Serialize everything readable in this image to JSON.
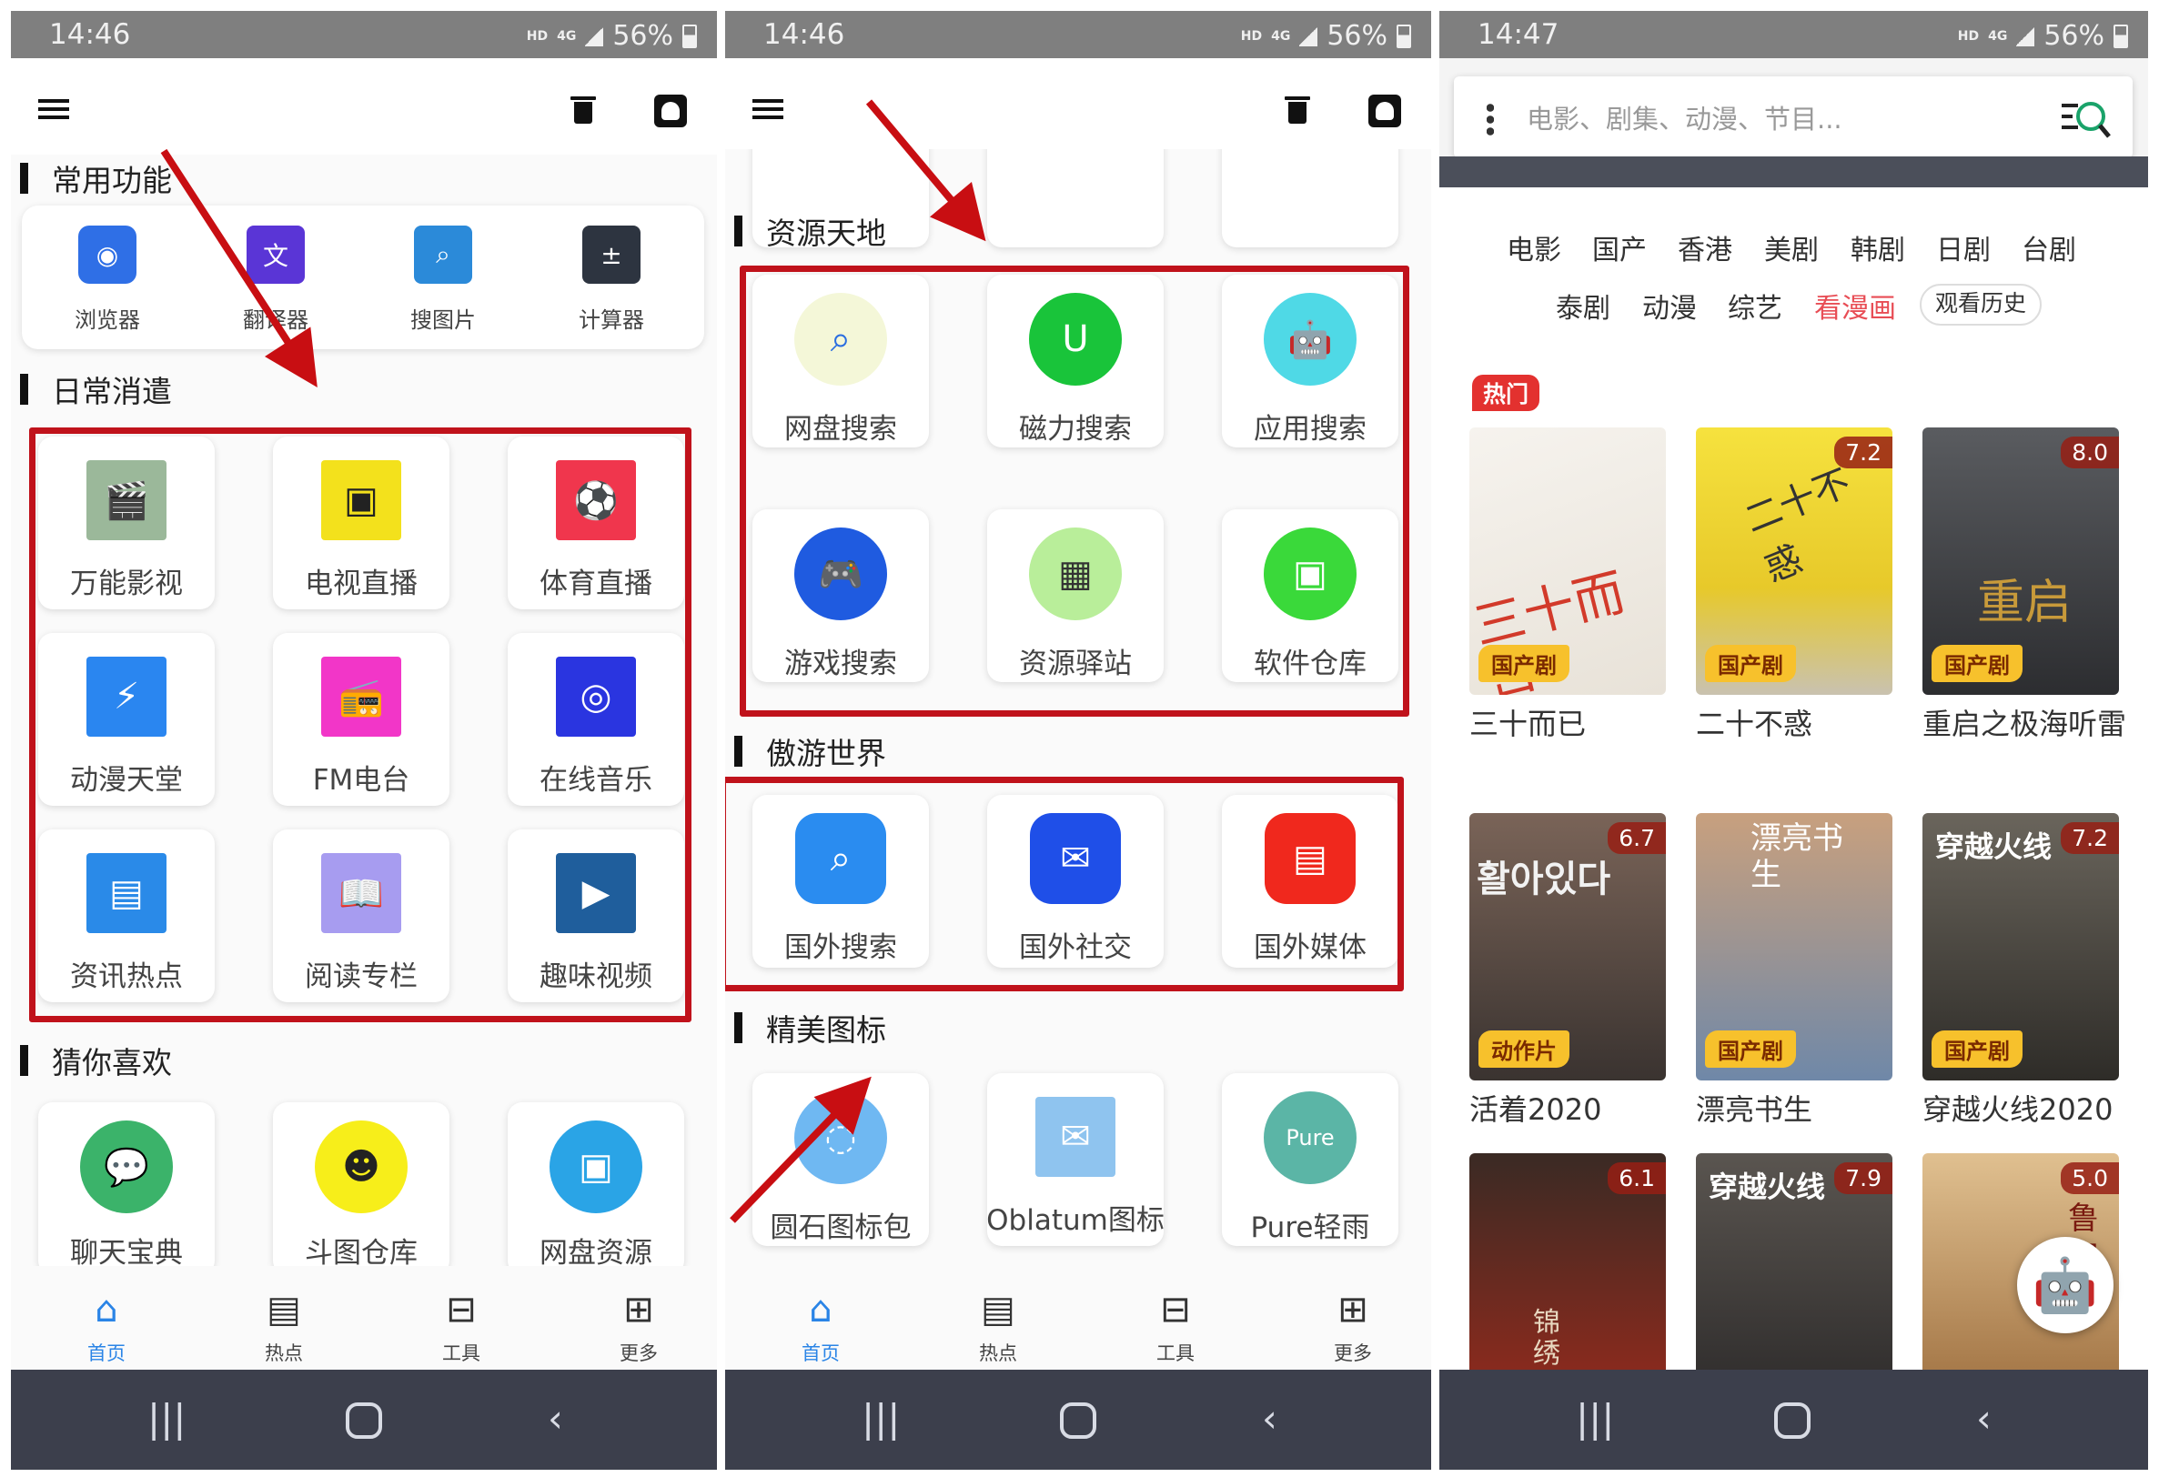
{
  "screens": [
    {
      "time": "14:46",
      "net": "HD",
      "gen": "4G",
      "battery": "56%",
      "sections": {
        "common": "常用功能",
        "daily": "日常消遣",
        "guess": "猜你喜欢"
      },
      "quick": [
        {
          "label": "浏览器",
          "icon": "browser-icon",
          "color": "#2f6fe6"
        },
        {
          "label": "翻译器",
          "icon": "translate-icon",
          "color": "#5a35d6"
        },
        {
          "label": "搜图片",
          "icon": "image-search-icon",
          "color": "#2b8ad9"
        },
        {
          "label": "计算器",
          "icon": "calculator-icon",
          "color": "#2d3440"
        }
      ],
      "daily": [
        {
          "label": "万能影视",
          "icon": "clapperboard-icon",
          "color": "#9bb89a"
        },
        {
          "label": "电视直播",
          "icon": "tv-icon",
          "color": "#f3e11c"
        },
        {
          "label": "体育直播",
          "icon": "football-icon",
          "color": "#f0364d"
        },
        {
          "label": "动漫天堂",
          "icon": "pikachu-icon",
          "color": "#2a86f0"
        },
        {
          "label": "FM电台",
          "icon": "radio-icon",
          "color": "#f236c8"
        },
        {
          "label": "在线音乐",
          "icon": "music-player-icon",
          "color": "#2a35e0"
        },
        {
          "label": "资讯热点",
          "icon": "news-icon",
          "color": "#2a8ae8"
        },
        {
          "label": "阅读专栏",
          "icon": "book-icon",
          "color": "#a79cf0"
        },
        {
          "label": "趣味视频",
          "icon": "video-icon",
          "color": "#1f5e9c"
        }
      ],
      "guess": [
        {
          "label": "聊天宝典",
          "icon": "chat-icon",
          "color": "#3bb36a"
        },
        {
          "label": "斗图仓库",
          "icon": "smiley-icon",
          "color": "#f7ee1a"
        },
        {
          "label": "网盘资源",
          "icon": "floppy-icon",
          "color": "#2aa4e6"
        }
      ]
    },
    {
      "time": "14:46",
      "sections": {
        "resources": "资源天地",
        "world": "傲游世界",
        "icons": "精美图标"
      },
      "resources": [
        {
          "label": "网盘搜索",
          "icon": "disk-search-icon",
          "color": "#f4f7d8"
        },
        {
          "label": "磁力搜索",
          "icon": "magnet-icon",
          "color": "#19c43a"
        },
        {
          "label": "应用搜索",
          "icon": "android-icon",
          "color": "#4fd9e6"
        },
        {
          "label": "游戏搜索",
          "icon": "gamepad-icon",
          "color": "#1f5be0"
        },
        {
          "label": "资源驿站",
          "icon": "shop-icon",
          "color": "#b9ee9a"
        },
        {
          "label": "软件仓库",
          "icon": "store-icon",
          "color": "#3ad93a"
        }
      ],
      "world": [
        {
          "label": "国外搜索",
          "icon": "globe-search-icon",
          "color": "#2a8cf0"
        },
        {
          "label": "国外社交",
          "icon": "messages-icon",
          "color": "#1f4fe8"
        },
        {
          "label": "国外媒体",
          "icon": "newspaper-icon",
          "color": "#f0281d"
        }
      ],
      "icons": [
        {
          "label": "圆石图标包",
          "icon": "round-stone-icon",
          "color": "#6fb8f2"
        },
        {
          "label": "Oblatum图标",
          "icon": "oblatum-icon",
          "color": "#8fc4ef"
        },
        {
          "label": "Pure轻雨",
          "icon": "pure-icon",
          "color": "#5bb5a6",
          "text": "Pure"
        }
      ]
    },
    {
      "time": "14:47",
      "search_placeholder": "电影、剧集、动漫、节目...",
      "categories_row1": [
        "电影",
        "国产",
        "香港",
        "美剧",
        "韩剧",
        "日剧",
        "台剧"
      ],
      "categories_row2": [
        "泰剧",
        "动漫",
        "综艺",
        "看漫画"
      ],
      "history": "观看历史",
      "hot": "热门",
      "posters": [
        {
          "title": "三十而已",
          "rating": "",
          "genre": "国产剧",
          "bg": "#f1ede6"
        },
        {
          "title": "二十不惑",
          "rating": "7.2",
          "genre": "国产剧",
          "bg": "#f1d93c"
        },
        {
          "title": "重启之极海听雷",
          "rating": "8.0",
          "genre": "国产剧",
          "bg": "#3b3d40"
        },
        {
          "title": "活着2020",
          "rating": "6.7",
          "genre": "动作片",
          "bg": "#5d4a40"
        },
        {
          "title": "漂亮书生",
          "rating": "",
          "genre": "国产剧",
          "bg": "#b48a6a"
        },
        {
          "title": "穿越火线2020",
          "rating": "7.2",
          "genre": "国产剧",
          "bg": "#4a4640"
        },
        {
          "title": "",
          "rating": "6.1",
          "genre": "",
          "bg": "#7a2418"
        },
        {
          "title": "",
          "rating": "7.9",
          "genre": "",
          "bg": "#3c3a3a"
        },
        {
          "title": "",
          "rating": "5.0",
          "genre": "",
          "bg": "#c99a5a"
        }
      ],
      "poster_texts": {
        "p0": "三十而已",
        "p1": "二十不惑",
        "p2": "重启",
        "p3": "활아있다",
        "p4": "漂亮书生",
        "p5": "穿越火线",
        "p6": "锦绣南歌",
        "p7": "穿越火线",
        "p8": "鲁锅"
      }
    }
  ],
  "tabs": [
    {
      "label": "首页",
      "icon": "home-icon",
      "glyph": "⌂"
    },
    {
      "label": "热点",
      "icon": "article-icon",
      "glyph": "▤"
    },
    {
      "label": "工具",
      "icon": "toolbox-icon",
      "glyph": "⊟"
    },
    {
      "label": "更多",
      "icon": "grid-icon",
      "glyph": "⊞"
    }
  ],
  "colors": {
    "accent": "#2a84e6",
    "highlight_box": "#c0121b",
    "arrow": "#c80e12",
    "nav_bar": "#3c3f4c"
  }
}
